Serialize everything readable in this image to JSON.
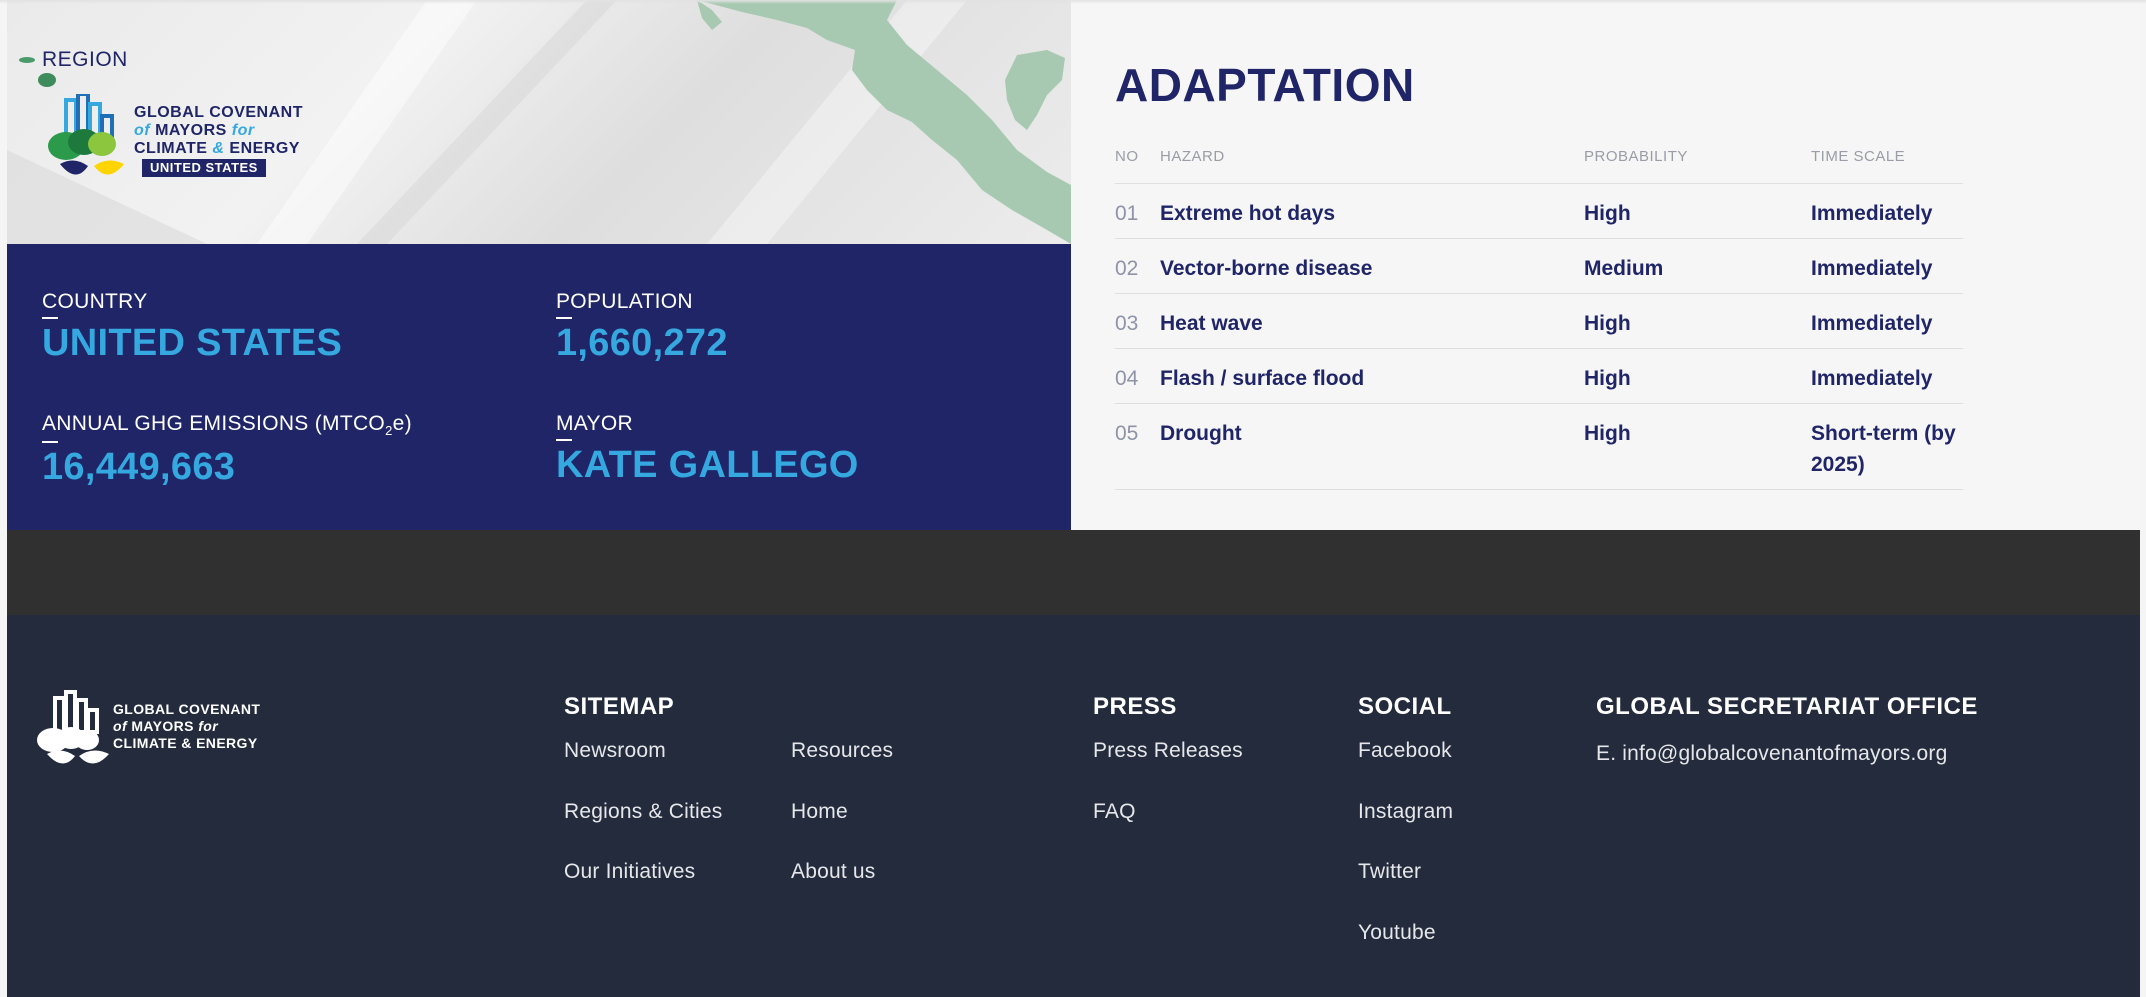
{
  "region": {
    "label": "REGION",
    "logo": {
      "line1": "GLOBAL COVENANT",
      "line2_of": "of",
      "line2_mayors": "MAYORS",
      "line2_for": "for",
      "line3_climate": "CLIMATE",
      "line3_amp": "&",
      "line3_energy": "ENERGY",
      "badge": "UNITED STATES"
    },
    "map_land_color": "#a8c9b1"
  },
  "stats": {
    "country_label": "COUNTRY",
    "country_value": "UNITED STATES",
    "population_label": "POPULATION",
    "population_value": "1,660,272",
    "emissions_label_prefix": "ANNUAL GHG EMISSIONS (MTCO",
    "emissions_label_sub": "2",
    "emissions_label_suffix": "e)",
    "emissions_value": "16,449,663",
    "mayor_label": "MAYOR",
    "mayor_value": "KATE GALLEGO"
  },
  "adaptation": {
    "title": "ADAPTATION",
    "headers": {
      "no": "NO",
      "hazard": "HAZARD",
      "probability": "PROBABILITY",
      "time_scale": "TIME SCALE"
    },
    "rows": [
      {
        "no": "01",
        "hazard": "Extreme hot days",
        "probability": "High",
        "time_scale": "Immediately"
      },
      {
        "no": "02",
        "hazard": "Vector-borne disease",
        "probability": "Medium",
        "time_scale": "Immediately"
      },
      {
        "no": "03",
        "hazard": "Heat wave",
        "probability": "High",
        "time_scale": "Immediately"
      },
      {
        "no": "04",
        "hazard": "Flash / surface flood",
        "probability": "High",
        "time_scale": "Immediately"
      },
      {
        "no": "05",
        "hazard": "Drought",
        "probability": "High",
        "time_scale": "Short-term (by 2025)"
      }
    ]
  },
  "footer": {
    "logo": {
      "line1": "GLOBAL COVENANT",
      "line2_of": "of",
      "line2_mayors": "MAYORS",
      "line2_for": "for",
      "line3": "CLIMATE & ENERGY"
    },
    "sitemap": {
      "heading": "SITEMAP",
      "links": [
        "Newsroom",
        "Regions & Cities",
        "Our Initiatives",
        "Resources",
        "Home",
        "About us"
      ]
    },
    "press": {
      "heading": "PRESS",
      "links": [
        "Press Releases",
        "FAQ"
      ]
    },
    "social": {
      "heading": "SOCIAL",
      "links": [
        "Facebook",
        "Instagram",
        "Twitter",
        "Youtube"
      ]
    },
    "office": {
      "heading": "GLOBAL SECRETARIAT OFFICE",
      "email": "E. info@globalcovenantofmayors.org"
    }
  },
  "colors": {
    "navy": "#1f2567",
    "accent_blue": "#35a8e0",
    "footer_bg": "#232b3c",
    "band_bg": "#303030"
  }
}
